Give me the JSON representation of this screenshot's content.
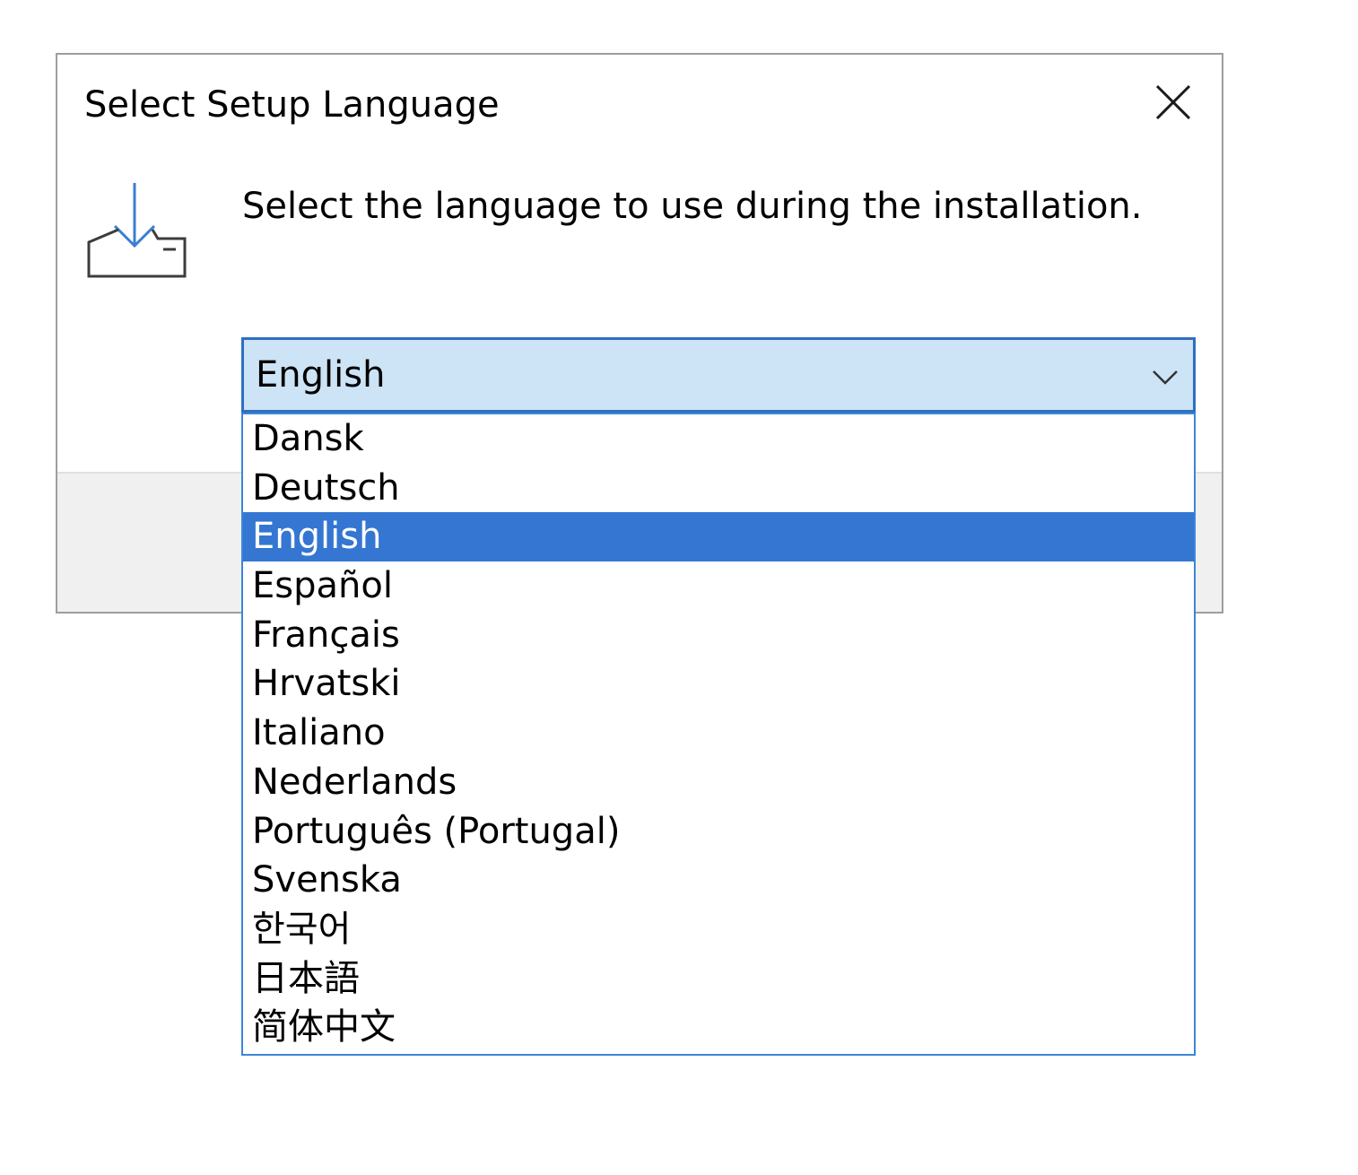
{
  "dialog": {
    "title": "Select Setup Language",
    "prompt": "Select the language to use during the installation.",
    "close_icon": "close-icon",
    "setup_icon": "install-download-icon"
  },
  "language_select": {
    "selected_value": "English",
    "expanded": true,
    "options": [
      "Dansk",
      "Deutsch",
      "English",
      "Español",
      "Français",
      "Hrvatski",
      "Italiano",
      "Nederlands",
      "Português (Portugal)",
      "Svenska",
      "한국어",
      "日本語",
      "简体中文"
    ],
    "highlighted_option": "English"
  },
  "colors": {
    "combo_background": "#cde3f6",
    "combo_border": "#2f6fbf",
    "selection_highlight": "#3476d2",
    "icon_accent": "#3a7fd0"
  }
}
